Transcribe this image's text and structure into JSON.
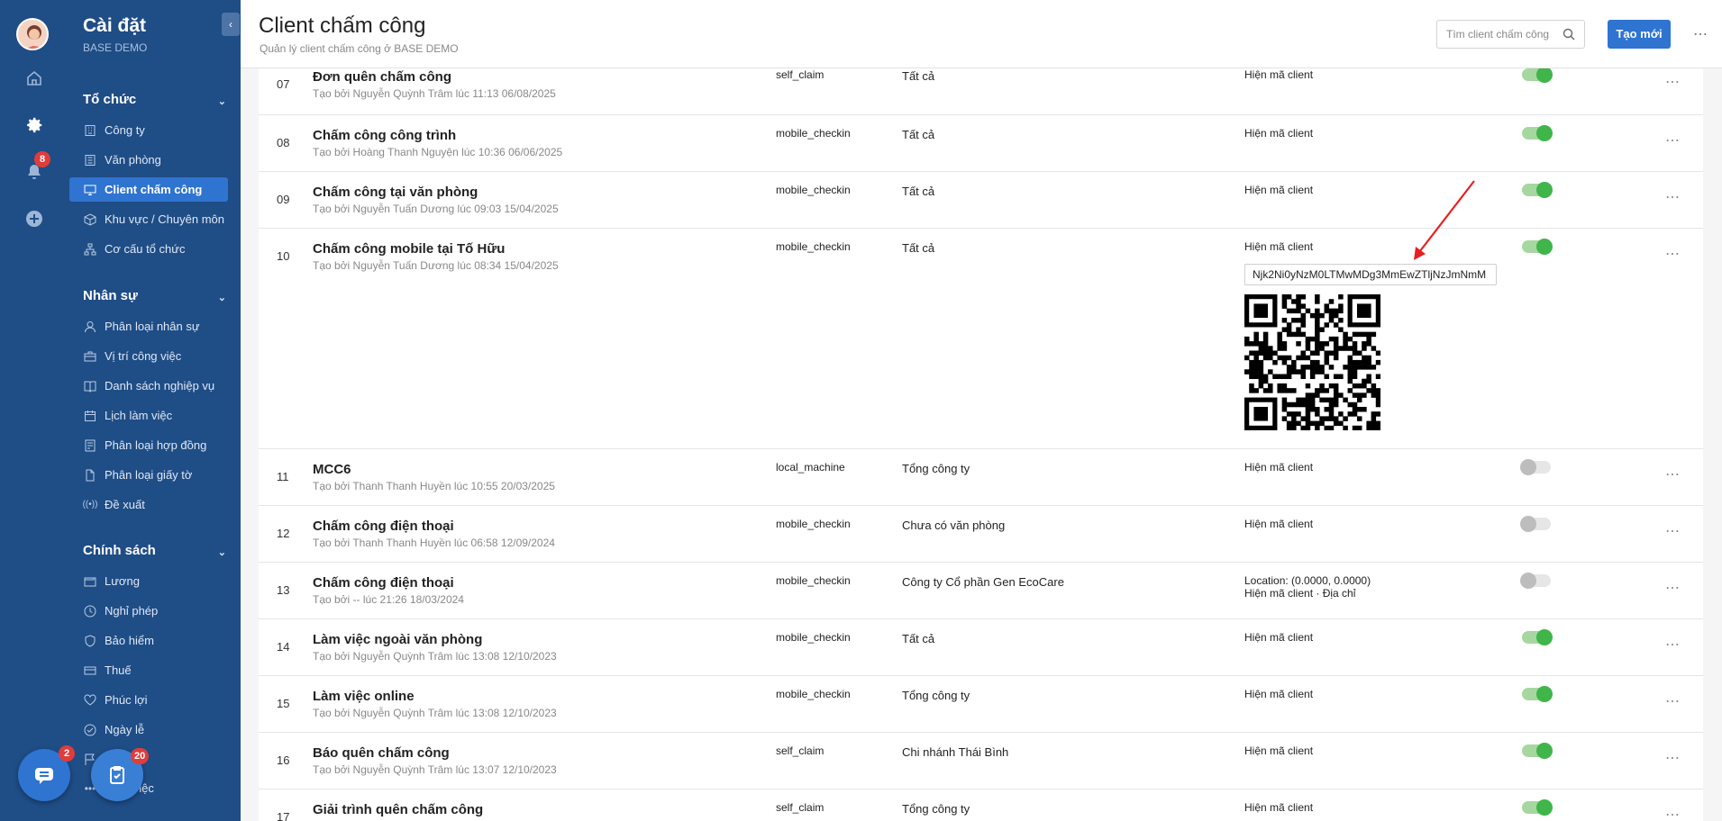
{
  "rail": {
    "notification_count": "8"
  },
  "sidebar": {
    "title": "Cài đặt",
    "subtitle": "BASE DEMO",
    "sections": [
      {
        "label": "Tổ chức",
        "items": [
          {
            "label": "Công ty",
            "icon": "building-icon"
          },
          {
            "label": "Văn phòng",
            "icon": "office-icon"
          },
          {
            "label": "Client chấm công",
            "icon": "monitor-icon",
            "active": true
          },
          {
            "label": "Khu vực / Chuyên môn",
            "icon": "cube-icon"
          },
          {
            "label": "Cơ cấu tổ chức",
            "icon": "org-chart-icon"
          }
        ]
      },
      {
        "label": "Nhân sự",
        "items": [
          {
            "label": "Phân loại nhân sự",
            "icon": "user-icon"
          },
          {
            "label": "Vị trí công việc",
            "icon": "briefcase-icon"
          },
          {
            "label": "Danh sách nghiệp vụ",
            "icon": "book-icon"
          },
          {
            "label": "Lịch làm việc",
            "icon": "calendar-icon"
          },
          {
            "label": "Phân loại hợp đồng",
            "icon": "contract-icon"
          },
          {
            "label": "Phân loại giấy tờ",
            "icon": "document-icon"
          },
          {
            "label": "Đề xuất",
            "icon": "broadcast-icon"
          }
        ]
      },
      {
        "label": "Chính sách",
        "items": [
          {
            "label": "Lương",
            "icon": "wallet-icon"
          },
          {
            "label": "Nghỉ phép",
            "icon": "clock-icon"
          },
          {
            "label": "Bảo hiểm",
            "icon": "shield-icon"
          },
          {
            "label": "Thuế",
            "icon": "card-icon"
          },
          {
            "label": "Phúc lợi",
            "icon": "heart-icon"
          },
          {
            "label": "Ngày lễ",
            "icon": "check-circle-icon"
          },
          {
            "label": "",
            "icon": "flag-icon"
          },
          {
            "label": "...ghỉ việc",
            "icon": "ellipsis-icon"
          }
        ]
      }
    ],
    "chat_badge": "2",
    "task_badge": "20"
  },
  "header": {
    "title": "Client chấm công",
    "subtitle": "Quản lý client chấm công ở BASE DEMO",
    "search_placeholder": "Tìm client chấm công",
    "new_button": "Tạo mới"
  },
  "rows": [
    {
      "idx": "07",
      "name": "Đơn quên chấm công",
      "by": "Tạo bởi Nguyễn Quỳnh Trâm lúc 11:13 06/08/2025",
      "type": "self_claim",
      "scope": "Tất cả",
      "info": "Hiện mã client",
      "enabled": true
    },
    {
      "idx": "08",
      "name": "Chấm công công trình",
      "by": "Tạo bởi Hoàng Thanh Nguyện lúc 10:36 06/06/2025",
      "type": "mobile_checkin",
      "scope": "Tất cả",
      "info": "Hiện mã client",
      "enabled": true
    },
    {
      "idx": "09",
      "name": "Chấm công tại văn phòng",
      "by": "Tạo bởi Nguyễn Tuấn Dương lúc 09:03 15/04/2025",
      "type": "mobile_checkin",
      "scope": "Tất cả",
      "info": "Hiện mã client",
      "enabled": true
    },
    {
      "idx": "10",
      "name": "Chấm công mobile tại Tố Hữu",
      "by": "Tạo bởi Nguyễn Tuấn Dương lúc 08:34 15/04/2025",
      "type": "mobile_checkin",
      "scope": "Tất cả",
      "info": "Hiện mã client",
      "enabled": true,
      "code": "Njk2Ni0yNzM0LTMwMDg3MmEwZTljNzJmNmM"
    },
    {
      "idx": "11",
      "name": "MCC6",
      "by": "Tạo bởi Thanh Thanh Huyền lúc 10:55 20/03/2025",
      "type": "local_machine",
      "scope": "Tổng công ty",
      "info": "Hiện mã client",
      "enabled": false
    },
    {
      "idx": "12",
      "name": "Chấm công điện thoại",
      "by": "Tạo bởi Thanh Thanh Huyền lúc 06:58 12/09/2024",
      "type": "mobile_checkin",
      "scope": "Chưa có văn phòng",
      "info": "Hiện mã client",
      "enabled": false
    },
    {
      "idx": "13",
      "name": "Chấm công điện thoại",
      "by": "Tạo bởi -- lúc 21:26 18/03/2024",
      "type": "mobile_checkin",
      "scope": "Công ty Cổ phần Gen EcoCare",
      "info_line1": "Location: (0.0000, 0.0000)",
      "info": "Hiện mã client · Địa chỉ",
      "enabled": false
    },
    {
      "idx": "14",
      "name": "Làm việc ngoài văn phòng",
      "by": "Tạo bởi Nguyễn Quỳnh Trâm lúc 13:08 12/10/2023",
      "type": "mobile_checkin",
      "scope": "Tất cả",
      "info": "Hiện mã client",
      "enabled": true
    },
    {
      "idx": "15",
      "name": "Làm việc online",
      "by": "Tạo bởi Nguyễn Quỳnh Trâm lúc 13:08 12/10/2023",
      "type": "mobile_checkin",
      "scope": "Tổng công ty",
      "info": "Hiện mã client",
      "enabled": true
    },
    {
      "idx": "16",
      "name": "Báo quên chấm công",
      "by": "Tạo bởi Nguyễn Quỳnh Trâm lúc 13:07 12/10/2023",
      "type": "self_claim",
      "scope": "Chi nhánh Thái Bình",
      "info": "Hiện mã client",
      "enabled": true
    },
    {
      "idx": "17",
      "name": "Giải trình quên chấm công",
      "by": "",
      "type": "self_claim",
      "scope": "Tổng công ty",
      "info": "Hiện mã client",
      "enabled": true
    }
  ],
  "colors": {
    "sidebar_bg": "#1f4d86",
    "accent": "#2e74d0",
    "toggle_on": "#3fb54a",
    "badge": "#e03c3c",
    "annotation_arrow": "#e62020"
  }
}
